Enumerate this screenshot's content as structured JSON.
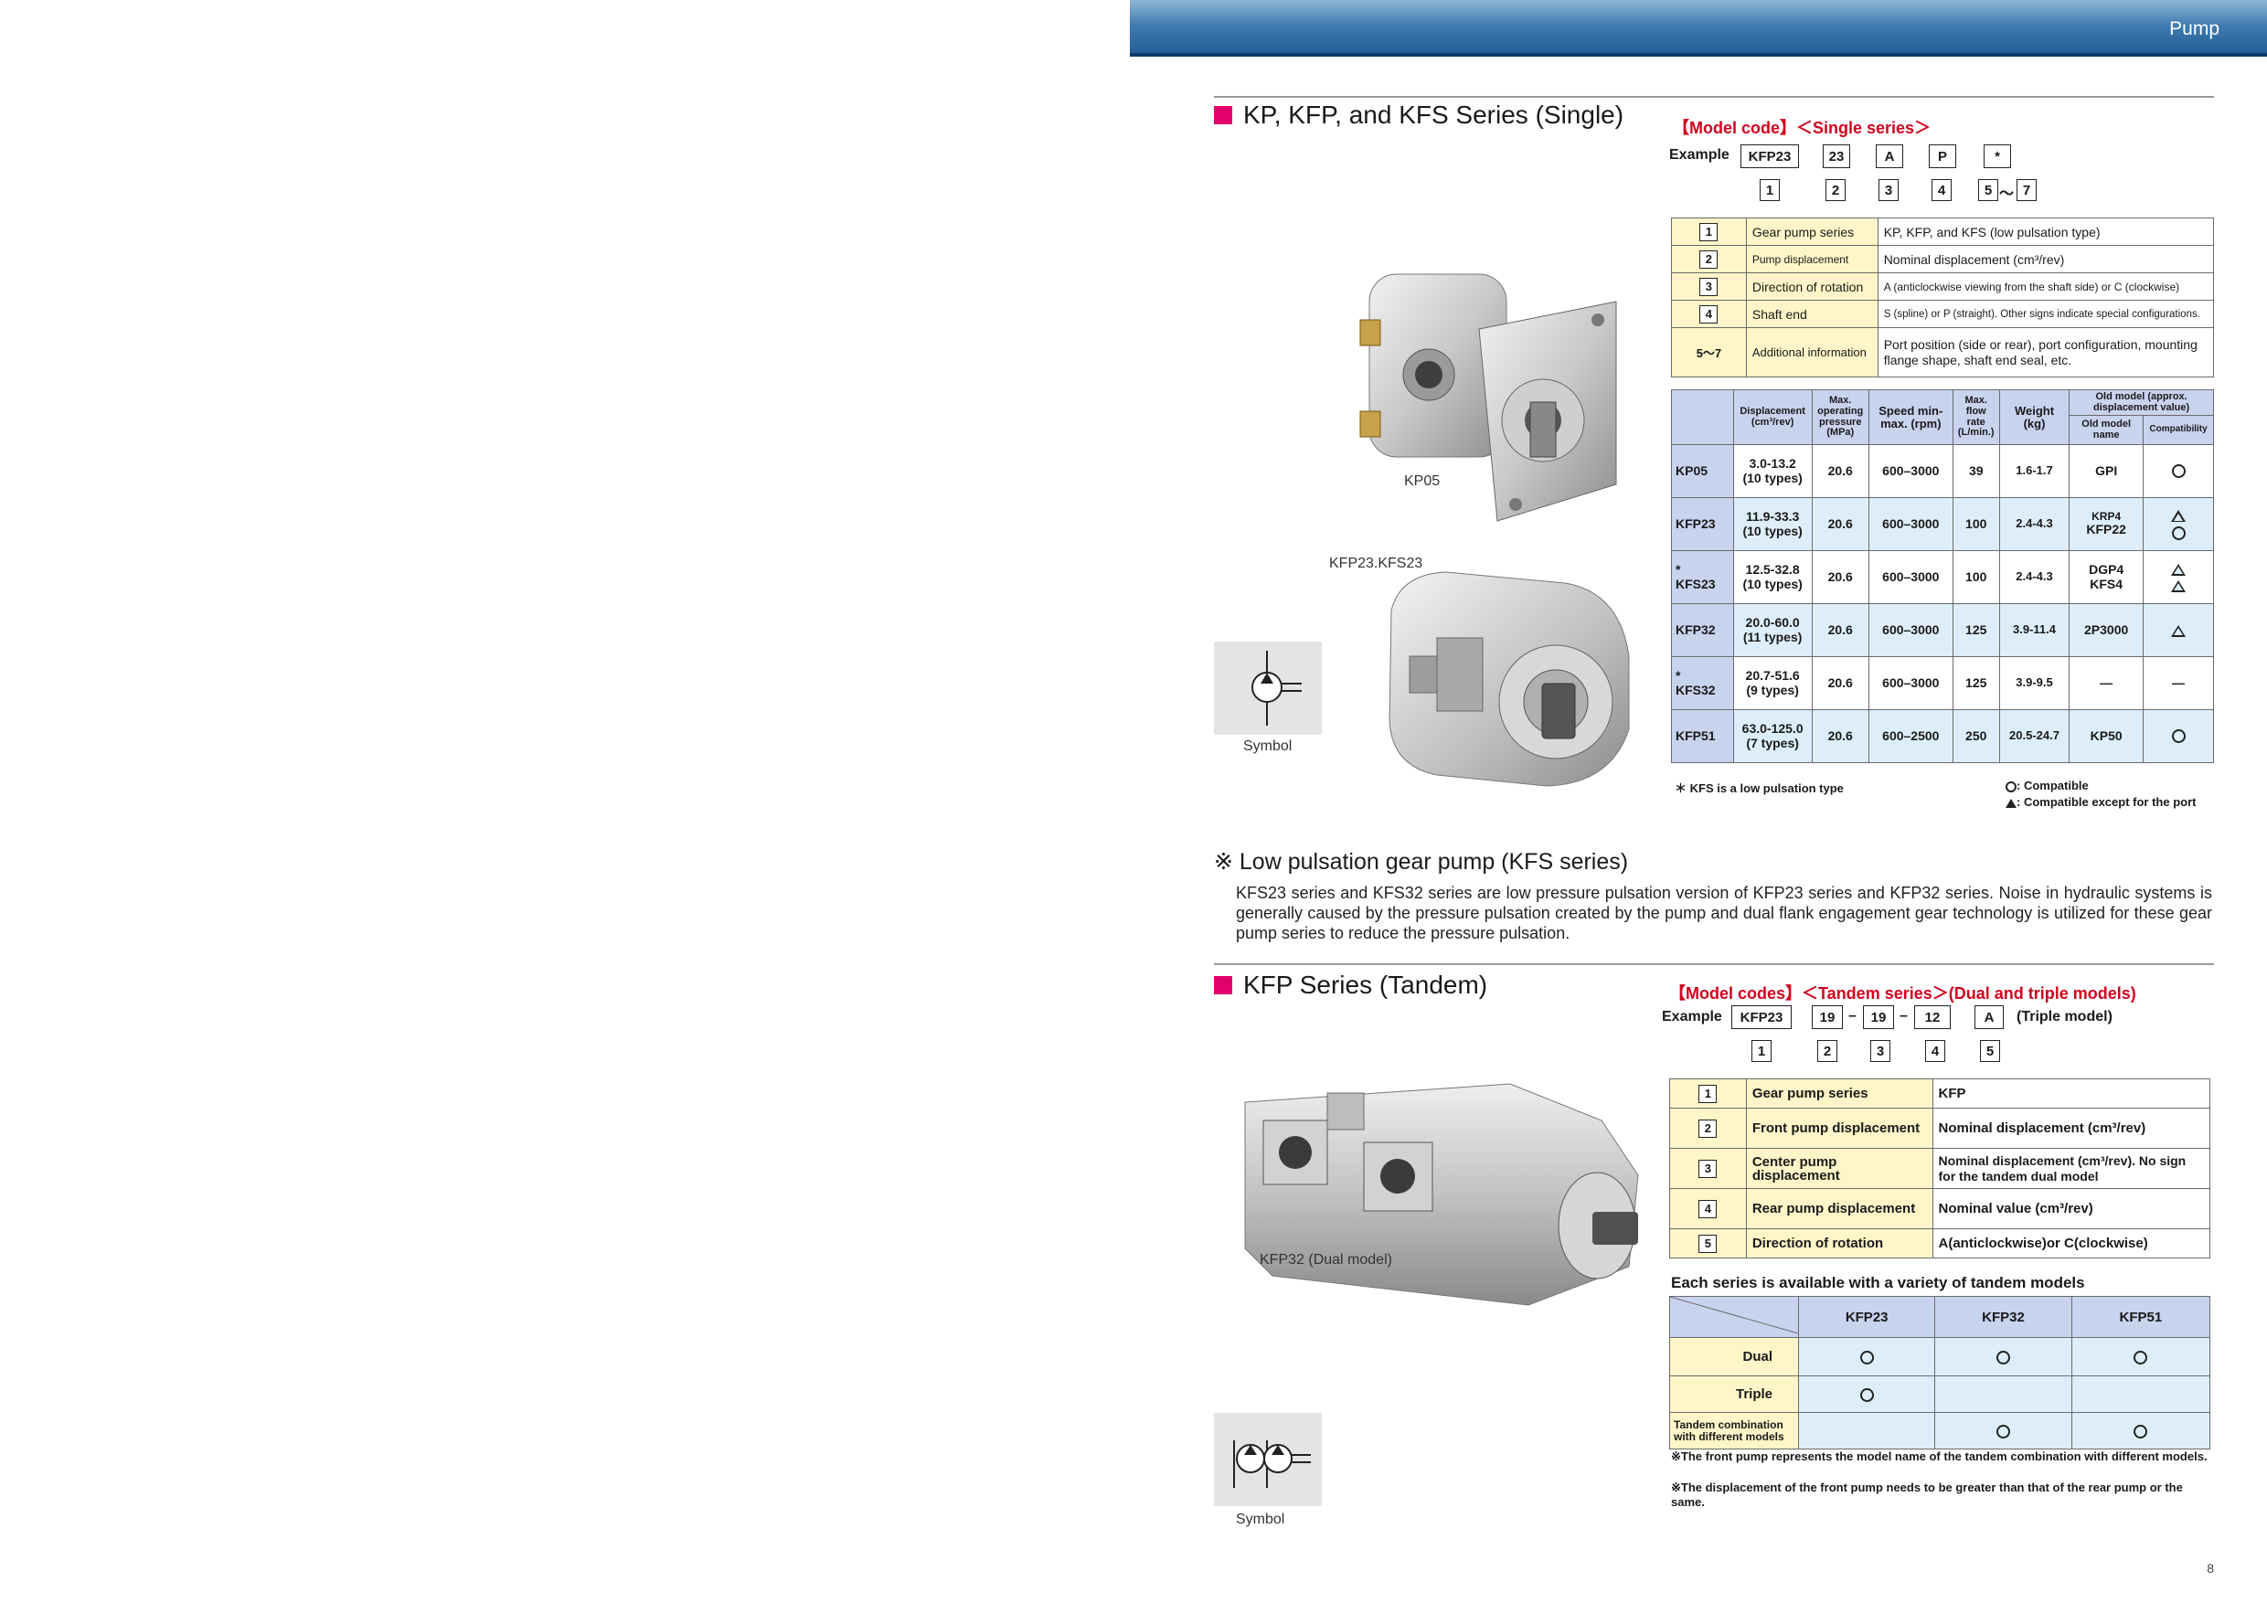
{
  "header": {
    "title": "Pump"
  },
  "single": {
    "title": "KP, KFP, and KFS Series (Single)",
    "model_code_label": "【Model code】＜Single series＞",
    "example_label": "Example",
    "example_codes": [
      "KFP23",
      "23",
      "A",
      "P",
      "*"
    ],
    "index_numbers": [
      "1",
      "2",
      "3",
      "4",
      "5",
      "7"
    ],
    "range_sep": "～",
    "legend": [
      {
        "num": "1",
        "item": "Gear pump series",
        "desc": "KP, KFP, and KFS (low pulsation type)"
      },
      {
        "num": "2",
        "item": "Pump displacement",
        "desc": "Nominal displacement (cm³/rev)"
      },
      {
        "num": "3",
        "item": "Direction of rotation",
        "desc": "A (anticlockwise viewing from the shaft side) or C (clockwise)"
      },
      {
        "num": "4",
        "item": "Shaft end",
        "desc": "S (spline) or P (straight). Other signs indicate special configurations."
      },
      {
        "num": "5～7",
        "item": "Additional information",
        "desc": "Port position (side or rear), port configuration, mounting flange shape, shaft end seal, etc."
      }
    ],
    "spec_headers": {
      "displacement": "Displacement (cm³/rev)",
      "pressure": "Max. operating pressure (MPa)",
      "speed": "Speed min-max. (rpm)",
      "flow": "Max. flow rate (L/min.)",
      "weight": "Weight (kg)",
      "old_model": "Old model (approx. displacement value)",
      "old_name": "Old model name",
      "compat": "Compatibility"
    },
    "spec_rows": [
      {
        "model": "KP05",
        "star": "",
        "disp": "3.0-13.2",
        "types": "(10 types)",
        "pressure": "20.6",
        "speed": "600–3000",
        "flow": "39",
        "weight": "1.6-1.7",
        "old": [
          "GPI"
        ],
        "compat": [
          "circle"
        ]
      },
      {
        "model": "KFP23",
        "star": "",
        "disp": "11.9-33.3",
        "types": "(10 types)",
        "pressure": "20.6",
        "speed": "600–3000",
        "flow": "100",
        "weight": "2.4-4.3",
        "old": [
          "KRP4",
          "KFP22"
        ],
        "compat": [
          "tri",
          "circle"
        ]
      },
      {
        "model": "KFS23",
        "star": "*",
        "disp": "12.5-32.8",
        "types": "(10 types)",
        "pressure": "20.6",
        "speed": "600–3000",
        "flow": "100",
        "weight": "2.4-4.3",
        "old": [
          "DGP4",
          "KFS4"
        ],
        "compat": [
          "tri",
          "tri"
        ]
      },
      {
        "model": "KFP32",
        "star": "",
        "disp": "20.0-60.0",
        "types": "(11 types)",
        "pressure": "20.6",
        "speed": "600–3000",
        "flow": "125",
        "weight": "3.9-11.4",
        "old": [
          "2P3000"
        ],
        "compat": [
          "tri"
        ]
      },
      {
        "model": "KFS32",
        "star": "*",
        "disp": "20.7-51.6",
        "types": "(9 types)",
        "pressure": "20.6",
        "speed": "600–3000",
        "flow": "125",
        "weight": "3.9-9.5",
        "old": [
          "—"
        ],
        "compat": [
          "—"
        ]
      },
      {
        "model": "KFP51",
        "star": "",
        "disp": "63.0-125.0",
        "types": "(7 types)",
        "pressure": "20.6",
        "speed": "600–2500",
        "flow": "250",
        "weight": "20.5-24.7",
        "old": [
          "KP50"
        ],
        "compat": [
          "circle"
        ]
      }
    ],
    "footnote": "＊ KFS is a low pulsation type",
    "compat_legend": [
      ": Compatible",
      ": Compatible except for the port"
    ],
    "photo_captions": {
      "kp05": "KP05",
      "kfp23": "KFP23.KFS23",
      "symbol": "Symbol"
    }
  },
  "low_pulsation": {
    "title": "※ Low pulsation gear pump (KFS series)",
    "body": "KFS23 series and KFS32 series are low pressure pulsation version of KFP23 series and KFP32 series. Noise in hydraulic systems is generally caused by the pressure pulsation created by the pump and dual flank engagement gear technology is utilized for these gear pump series to reduce the pressure pulsation."
  },
  "tandem": {
    "title": "KFP Series (Tandem)",
    "model_code_label": "【Model codes】＜Tandem series＞(Dual and triple models)",
    "example_label": "Example",
    "example_codes": [
      "KFP23",
      "19",
      "19",
      "12",
      "A"
    ],
    "dash": "–",
    "triple_note": "(Triple model)",
    "index_numbers": [
      "1",
      "2",
      "3",
      "4",
      "5"
    ],
    "legend": [
      {
        "num": "1",
        "item": "Gear pump series",
        "desc": "KFP"
      },
      {
        "num": "2",
        "item": "Front pump displacement",
        "desc": "Nominal displacement (cm³/rev)"
      },
      {
        "num": "3",
        "item": "Center pump displacement",
        "desc": "Nominal displacement (cm³/rev). No sign for the tandem dual model"
      },
      {
        "num": "4",
        "item": "Rear pump displacement",
        "desc": "Nominal value (cm³/rev)"
      },
      {
        "num": "5",
        "item": "Direction of rotation",
        "desc": "A(anticlockwise)or C(clockwise)"
      }
    ],
    "availability_title": "Each series is available with a variety of tandem models",
    "availability_columns": [
      "KFP23",
      "KFP32",
      "KFP51"
    ],
    "availability_rows": [
      {
        "label": "Dual",
        "values": [
          true,
          true,
          true
        ]
      },
      {
        "label": "Triple",
        "values": [
          true,
          false,
          false
        ]
      },
      {
        "label": "Tandem combination with different models",
        "values": [
          false,
          true,
          true
        ]
      }
    ],
    "notes": [
      "※The front pump represents the model name of the tandem combination with different models.",
      "※The displacement of the front pump needs to be greater than that of the rear pump or the same."
    ],
    "photo_caption": "KFP32 (Dual model)",
    "symbol_caption": "Symbol"
  },
  "page_number": "8",
  "colors": {
    "accent_pink": "#e2006a",
    "label_red": "#d2001e",
    "header_blue": "#1f5a93",
    "table_blue": "#c8d3ee",
    "table_yellow": "#fff5c8",
    "table_light_blue": "#ddeefa"
  }
}
